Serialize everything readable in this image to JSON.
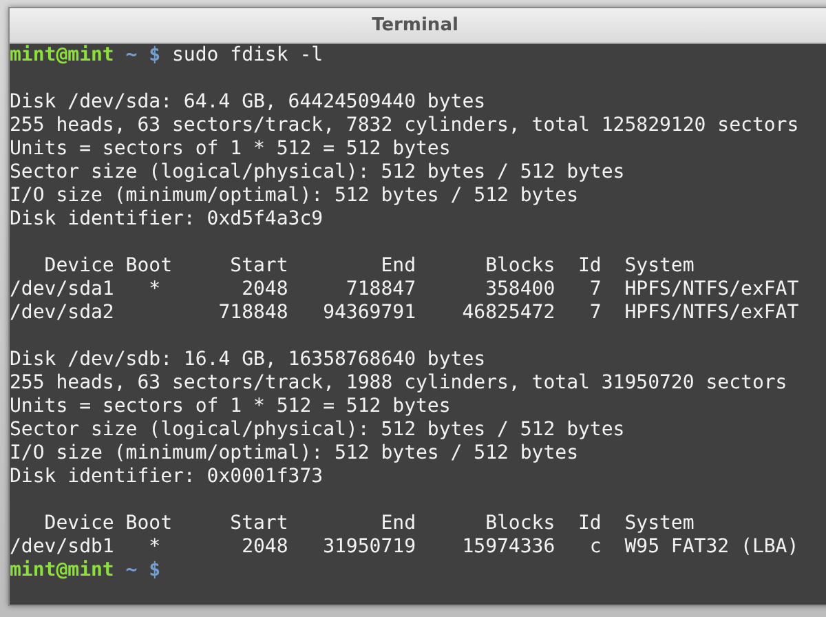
{
  "window": {
    "title": "Terminal"
  },
  "lines": [
    {
      "kind": "prompt",
      "user": "mint@mint",
      "path": "~",
      "symbol": "$",
      "command": "sudo fdisk -l"
    },
    {
      "kind": "blank"
    },
    {
      "kind": "output",
      "text": "Disk /dev/sda: 64.4 GB, 64424509440 bytes"
    },
    {
      "kind": "output",
      "text": "255 heads, 63 sectors/track, 7832 cylinders, total 125829120 sectors"
    },
    {
      "kind": "output",
      "text": "Units = sectors of 1 * 512 = 512 bytes"
    },
    {
      "kind": "output",
      "text": "Sector size (logical/physical): 512 bytes / 512 bytes"
    },
    {
      "kind": "output",
      "text": "I/O size (minimum/optimal): 512 bytes / 512 bytes"
    },
    {
      "kind": "output",
      "text": "Disk identifier: 0xd5f4a3c9"
    },
    {
      "kind": "blank"
    },
    {
      "kind": "output",
      "text": "   Device Boot     Start        End      Blocks  Id  System"
    },
    {
      "kind": "output",
      "text": "/dev/sda1   *       2048     718847      358400   7  HPFS/NTFS/exFAT"
    },
    {
      "kind": "output",
      "text": "/dev/sda2         718848   94369791    46825472   7  HPFS/NTFS/exFAT"
    },
    {
      "kind": "blank"
    },
    {
      "kind": "output",
      "text": "Disk /dev/sdb: 16.4 GB, 16358768640 bytes"
    },
    {
      "kind": "output",
      "text": "255 heads, 63 sectors/track, 1988 cylinders, total 31950720 sectors"
    },
    {
      "kind": "output",
      "text": "Units = sectors of 1 * 512 = 512 bytes"
    },
    {
      "kind": "output",
      "text": "Sector size (logical/physical): 512 bytes / 512 bytes"
    },
    {
      "kind": "output",
      "text": "I/O size (minimum/optimal): 512 bytes / 512 bytes"
    },
    {
      "kind": "output",
      "text": "Disk identifier: 0x0001f373"
    },
    {
      "kind": "blank"
    },
    {
      "kind": "output",
      "text": "   Device Boot     Start        End      Blocks  Id  System"
    },
    {
      "kind": "output",
      "text": "/dev/sdb1   *       2048   31950719    15974336   c  W95 FAT32 (LBA)"
    },
    {
      "kind": "prompt",
      "user": "mint@mint",
      "path": "~",
      "symbol": "$"
    }
  ]
}
